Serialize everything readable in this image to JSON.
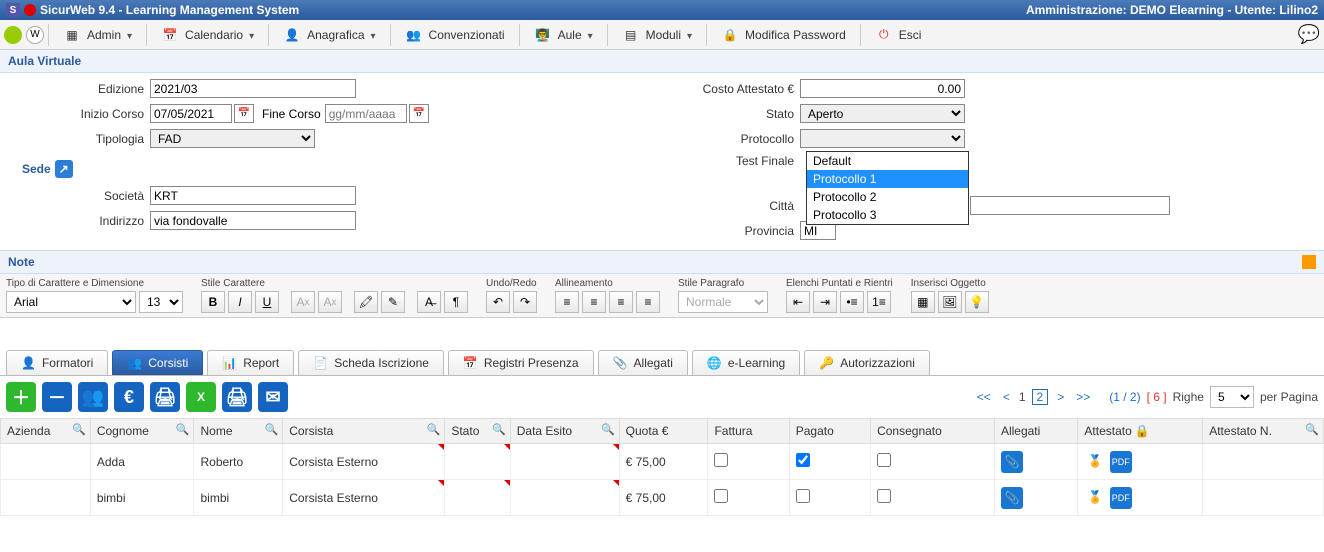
{
  "titlebar": {
    "app": "SicurWeb 9.4 - Learning Management System",
    "right": "Amministrazione: DEMO Elearning - Utente: Lilino2"
  },
  "menu": {
    "admin": "Admin",
    "calendario": "Calendario",
    "anagrafica": "Anagrafica",
    "convenzionati": "Convenzionati",
    "aule": "Aule",
    "moduli": "Moduli",
    "password": "Modifica Password",
    "esci": "Esci"
  },
  "section": "Aula Virtuale",
  "form": {
    "edizione_lbl": "Edizione",
    "edizione": "2021/03",
    "inizio_lbl": "Inizio Corso",
    "inizio": "07/05/2021",
    "fine_lbl": "Fine Corso",
    "fine_ph": "gg/mm/aaaa",
    "tipologia_lbl": "Tipologia",
    "tipologia": "FAD",
    "sede": "Sede",
    "societa_lbl": "Società",
    "societa": "KRT",
    "indirizzo_lbl": "Indirizzo",
    "indirizzo": "via fondovalle",
    "costo_lbl": "Costo Attestato €",
    "costo": "0.00",
    "stato_lbl": "Stato",
    "stato": "Aperto",
    "protocollo_lbl": "Protocollo",
    "testfinale_lbl": "Test Finale",
    "citta_lbl": "Città",
    "provincia_lbl": "Provincia",
    "provincia": "MI"
  },
  "protocollo_options": [
    "Default",
    "Protocollo 1",
    "Protocollo 2",
    "Protocollo 3"
  ],
  "protocollo_selected_index": 1,
  "note": {
    "title": "Note",
    "groups": {
      "font": "Tipo di Carattere e Dimensione",
      "font_name": "Arial",
      "font_size": "13",
      "style": "Stile Carattere",
      "undo": "Undo/Redo",
      "align": "Allineamento",
      "para": "Stile Paragrafo",
      "para_val": "Normale",
      "lists": "Elenchi Puntati e Rientri",
      "insert": "Inserisci Oggetto"
    }
  },
  "tabs": [
    "Formatori",
    "Corsisti",
    "Report",
    "Scheda Iscrizione",
    "Registri Presenza",
    "Allegati",
    "e-Learning",
    "Autorizzazioni"
  ],
  "active_tab": 1,
  "pager": {
    "pages_label": "(1 / 2)",
    "total_label": "[ 6 ]",
    "righe_lbl": "Righe",
    "righe": "5",
    "per": "per Pagina"
  },
  "grid": {
    "columns": [
      "Azienda",
      "Cognome",
      "Nome",
      "Corsista",
      "Stato",
      "Data Esito",
      "Quota €",
      "Fattura",
      "Pagato",
      "Consegnato",
      "Allegati",
      "Attestato",
      "Attestato N."
    ],
    "rows": [
      {
        "azienda": "",
        "cognome": "Adda",
        "nome": "Roberto",
        "corsista": "Corsista Esterno",
        "stato": "",
        "data": "",
        "quota": "€ 75,00",
        "fattura": false,
        "pagato": true,
        "consegnato": false
      },
      {
        "azienda": "",
        "cognome": "bimbi",
        "nome": "bimbi",
        "corsista": "Corsista Esterno",
        "stato": "",
        "data": "",
        "quota": "€ 75,00",
        "fattura": false,
        "pagato": false,
        "consegnato": false
      }
    ]
  }
}
